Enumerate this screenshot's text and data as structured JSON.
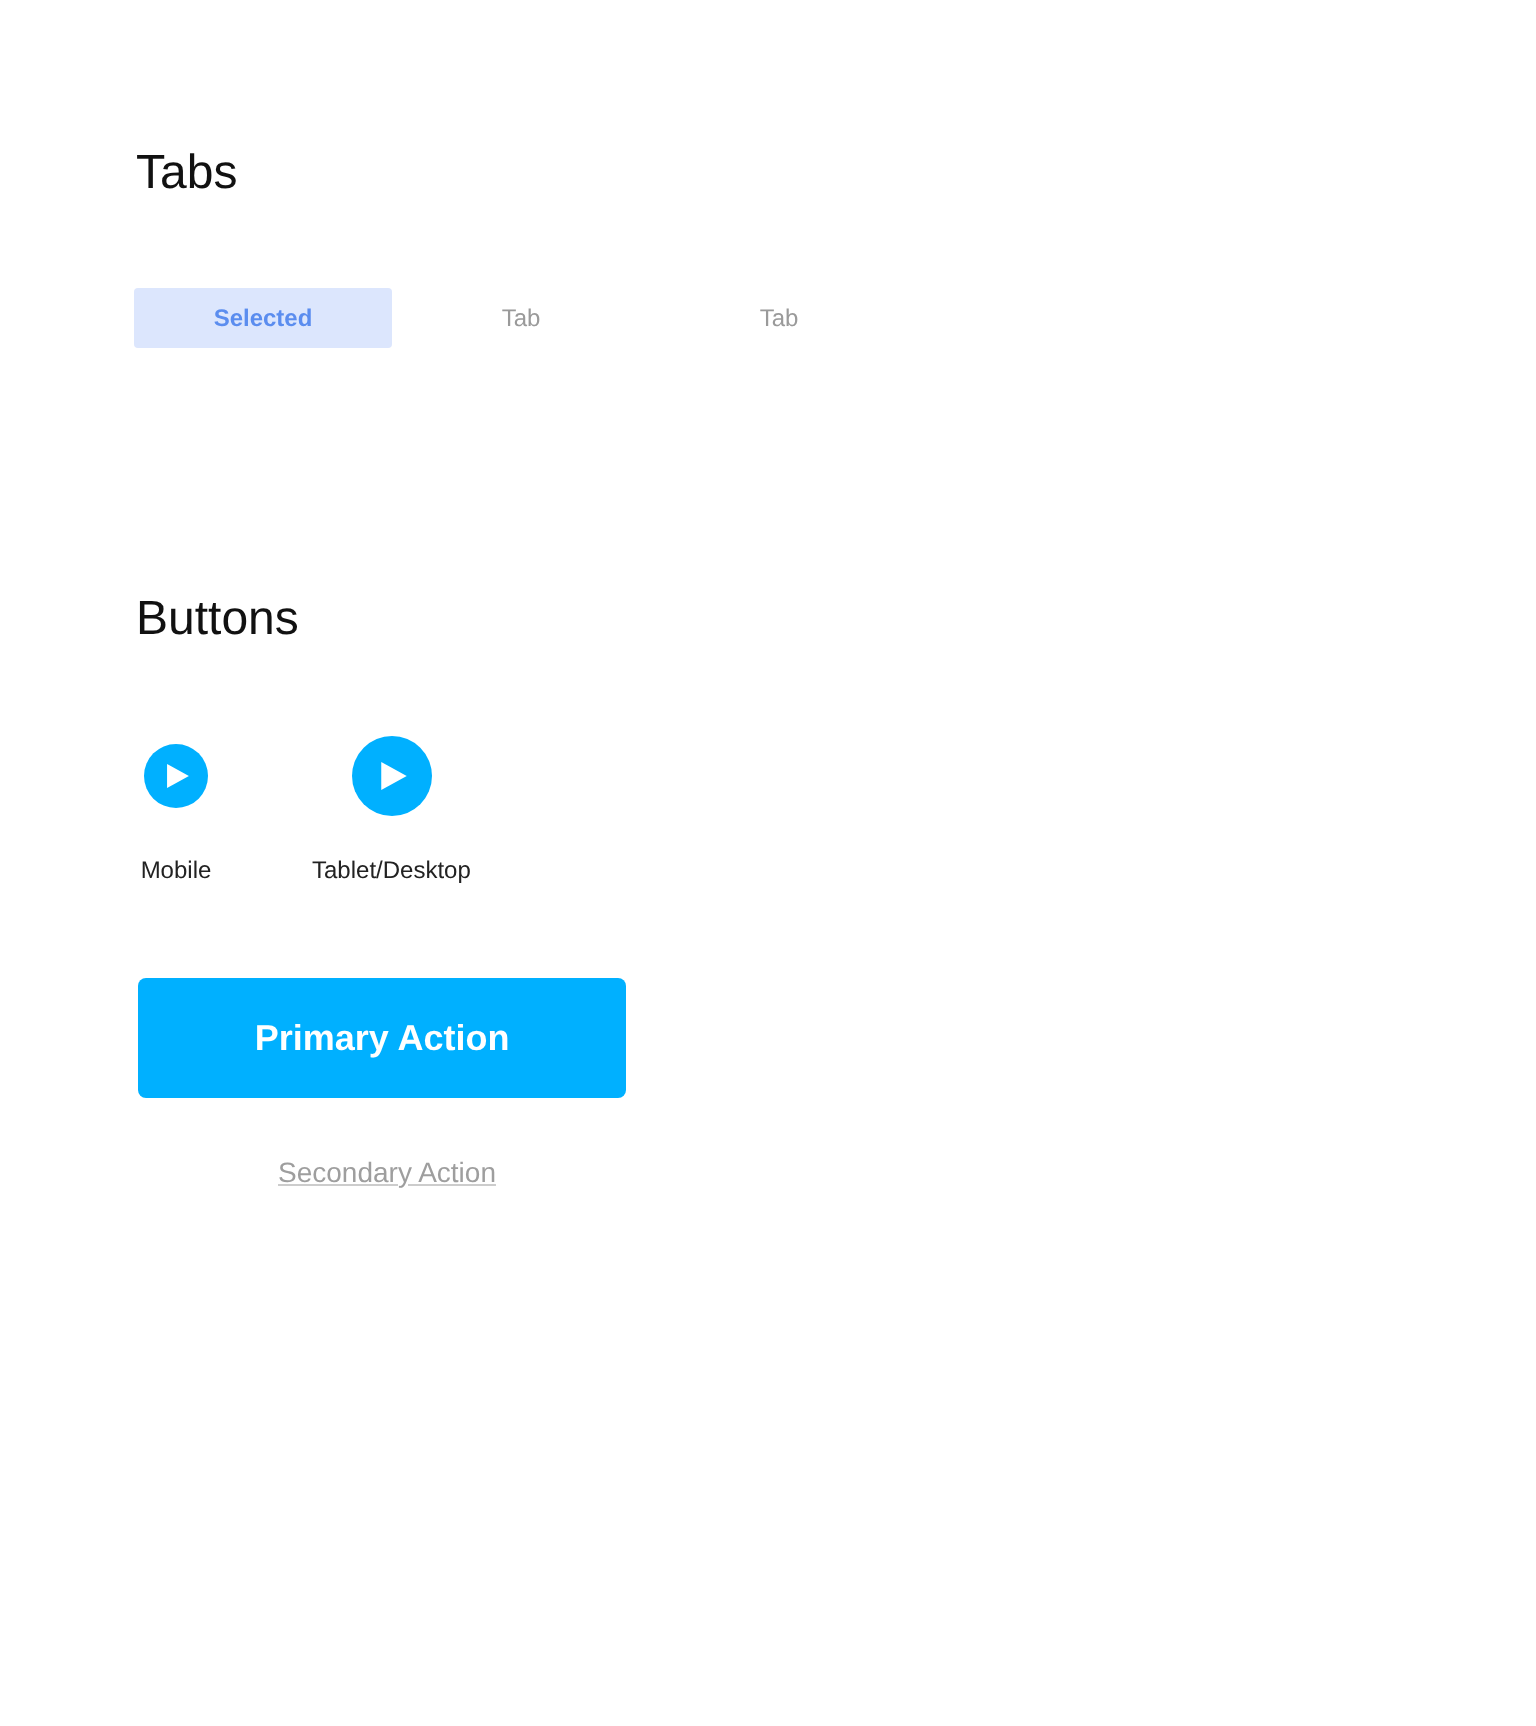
{
  "tabs_section": {
    "title": "Tabs",
    "tabs": [
      {
        "label": "Selected",
        "selected": true
      },
      {
        "label": "Tab",
        "selected": false
      },
      {
        "label": "Tab",
        "selected": false
      }
    ]
  },
  "buttons_section": {
    "title": "Buttons",
    "play_buttons": [
      {
        "kind": "small",
        "label": "Mobile"
      },
      {
        "kind": "large",
        "label": "Tablet/Desktop"
      }
    ],
    "primary_button": {
      "label": "Primary Action"
    },
    "secondary_link": {
      "label": "Secondary Action"
    }
  }
}
